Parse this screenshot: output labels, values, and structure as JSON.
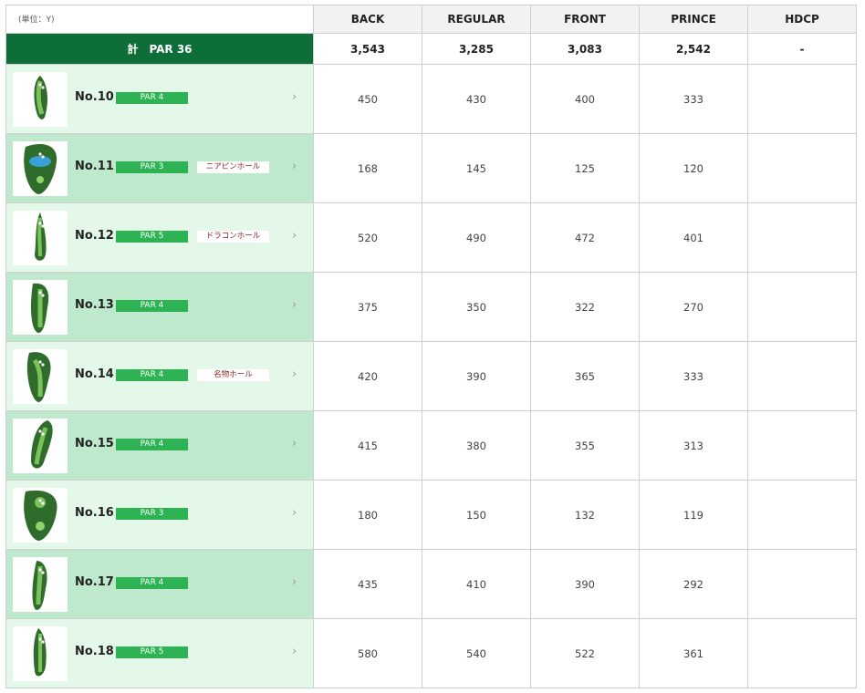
{
  "unit_note": "(単位：Y)",
  "columns": [
    "BACK",
    "REGULAR",
    "FRONT",
    "PRINCE",
    "HDCP"
  ],
  "total": {
    "label": "計　PAR 36",
    "values": [
      "3,543",
      "3,285",
      "3,083",
      "2,542",
      "-"
    ]
  },
  "holes": [
    {
      "no": "No.10",
      "par": "PAR 4",
      "tag": "",
      "values": [
        "450",
        "430",
        "400",
        "333",
        ""
      ]
    },
    {
      "no": "No.11",
      "par": "PAR 3",
      "tag": "ニアピンホール",
      "values": [
        "168",
        "145",
        "125",
        "120",
        ""
      ]
    },
    {
      "no": "No.12",
      "par": "PAR 5",
      "tag": "ドラコンホール",
      "values": [
        "520",
        "490",
        "472",
        "401",
        ""
      ]
    },
    {
      "no": "No.13",
      "par": "PAR 4",
      "tag": "",
      "values": [
        "375",
        "350",
        "322",
        "270",
        ""
      ]
    },
    {
      "no": "No.14",
      "par": "PAR 4",
      "tag": "名物ホール",
      "values": [
        "420",
        "390",
        "365",
        "333",
        ""
      ]
    },
    {
      "no": "No.15",
      "par": "PAR 4",
      "tag": "",
      "values": [
        "415",
        "380",
        "355",
        "313",
        ""
      ]
    },
    {
      "no": "No.16",
      "par": "PAR 3",
      "tag": "",
      "values": [
        "180",
        "150",
        "132",
        "119",
        ""
      ]
    },
    {
      "no": "No.17",
      "par": "PAR 4",
      "tag": "",
      "values": [
        "435",
        "410",
        "390",
        "292",
        ""
      ]
    },
    {
      "no": "No.18",
      "par": "PAR 5",
      "tag": "",
      "values": [
        "580",
        "540",
        "522",
        "361",
        ""
      ]
    }
  ],
  "icons": {
    "hole_thumbnail": "golf-hole-map-icon",
    "row_arrow": "chevron-right-icon"
  },
  "colors": {
    "total_bg": "#0e6e3a",
    "par_badge": "#2db354",
    "row_light": "#e4f8ea",
    "row_dark": "#bfe9cd",
    "tag_text": "#8b1d1d"
  }
}
